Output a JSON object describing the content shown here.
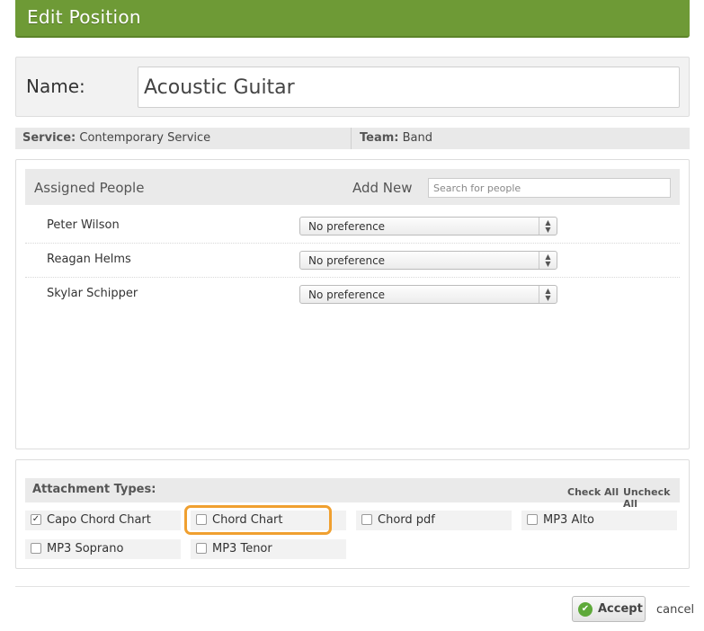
{
  "header": {
    "title": "Edit Position"
  },
  "name": {
    "label": "Name:",
    "value": "Acoustic Guitar"
  },
  "meta": {
    "service_label": "Service:",
    "service_value": "Contemporary Service",
    "team_label": "Team:",
    "team_value": "Band"
  },
  "people": {
    "assigned_label": "Assigned People",
    "add_new_label": "Add New",
    "search_placeholder": "Search for people",
    "rows": [
      {
        "name": "Peter Wilson",
        "preference": "No preference"
      },
      {
        "name": "Reagan Helms",
        "preference": "No preference"
      },
      {
        "name": "Skylar Schipper",
        "preference": "No preference"
      }
    ]
  },
  "attachments": {
    "title": "Attachment Types:",
    "check_all": "Check All",
    "uncheck_all": "Uncheck All",
    "items": [
      {
        "label": "Capo Chord Chart",
        "checked": true
      },
      {
        "label": "Chord Chart",
        "checked": false
      },
      {
        "label": "Chord pdf",
        "checked": false
      },
      {
        "label": "MP3 Alto",
        "checked": false
      },
      {
        "label": "MP3 Soprano",
        "checked": false
      },
      {
        "label": "MP3 Tenor",
        "checked": false
      }
    ]
  },
  "footer": {
    "accept_label": "Accept",
    "cancel_label": "cancel"
  },
  "colors": {
    "header_green": "#6e9a36",
    "accept_icon_green": "#5ea93a",
    "highlight_orange": "#f0a030"
  }
}
